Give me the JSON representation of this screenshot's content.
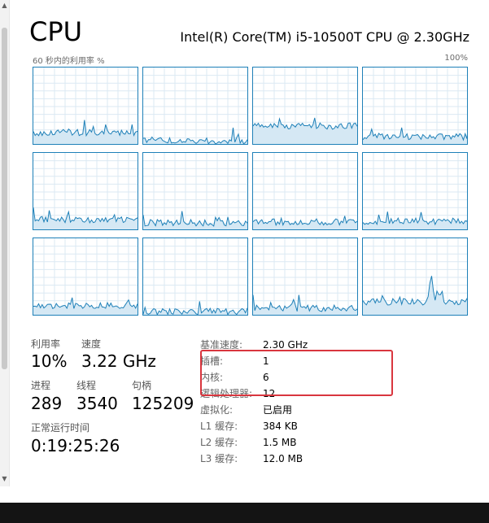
{
  "header": {
    "title": "CPU",
    "cpu_model": "Intel(R) Core(TM) i5-10500T CPU @ 2.30GHz"
  },
  "graph": {
    "axis_left_label": "60 秒内的利用率 %",
    "axis_right_label": "100%",
    "grid_color": "#1e80b8",
    "fill_color": "#d5e8f4",
    "line_color": "#1e80b8",
    "logical_processor_count": 12
  },
  "stats": {
    "utilization": {
      "label": "利用率",
      "value": "10%"
    },
    "speed": {
      "label": "速度",
      "value": "3.22 GHz"
    },
    "processes": {
      "label": "进程",
      "value": "289"
    },
    "threads": {
      "label": "线程",
      "value": "3540"
    },
    "handles": {
      "label": "句柄",
      "value": "125209"
    },
    "uptime": {
      "label": "正常运行时间",
      "value": "0:19:25:26"
    }
  },
  "specs": [
    {
      "key": "基准速度:",
      "value": "2.30 GHz"
    },
    {
      "key": "插槽:",
      "value": "1"
    },
    {
      "key": "内核:",
      "value": "6"
    },
    {
      "key": "逻辑处理器:",
      "value": "12"
    },
    {
      "key": "虚拟化:",
      "value": "已启用"
    },
    {
      "key": "L1 缓存:",
      "value": "384 KB"
    },
    {
      "key": "L2 缓存:",
      "value": "1.5 MB"
    },
    {
      "key": "L3 缓存:",
      "value": "12.0 MB"
    }
  ],
  "highlight_color": "#d9363e"
}
